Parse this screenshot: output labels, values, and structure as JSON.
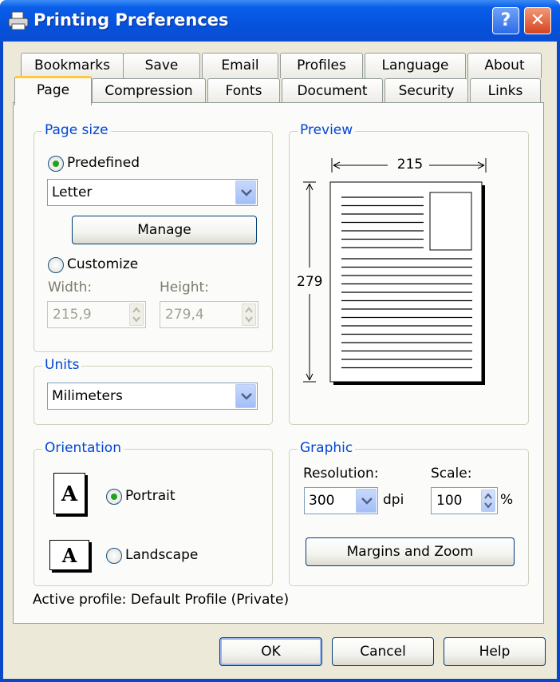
{
  "window": {
    "title": "Printing Preferences",
    "help_label": "?",
    "close_label": "✕"
  },
  "tabs_back": [
    "Bookmarks",
    "Save",
    "Email",
    "Profiles",
    "Language",
    "About"
  ],
  "tabs_front": [
    "Page",
    "Compression",
    "Fonts",
    "Document",
    "Security",
    "Links"
  ],
  "page_size": {
    "label": "Page size",
    "predefined_label": "Predefined",
    "predefined_selected": true,
    "paper_value": "Letter",
    "manage_label": "Manage",
    "customize_label": "Customize",
    "customize_selected": false,
    "width_label": "Width:",
    "width_value": "215,9",
    "height_label": "Height:",
    "height_value": "279,4"
  },
  "units": {
    "label": "Units",
    "value": "Milimeters"
  },
  "preview": {
    "label": "Preview",
    "width_dim": "215",
    "height_dim": "279"
  },
  "orientation": {
    "label": "Orientation",
    "portrait_label": "Portrait",
    "portrait_selected": true,
    "landscape_label": "Landscape",
    "landscape_selected": false,
    "icon_letter": "A"
  },
  "graphic": {
    "label": "Graphic",
    "resolution_label": "Resolution:",
    "resolution_value": "300",
    "dpi_label": "dpi",
    "scale_label": "Scale:",
    "scale_value": "100",
    "percent_label": "%",
    "margins_zoom_label": "Margins and Zoom"
  },
  "active_profile": "Active profile: Default Profile (Private)",
  "footer": {
    "ok_label": "OK",
    "cancel_label": "Cancel",
    "help_label": "Help"
  },
  "icons": [
    "printer-icon",
    "help-icon",
    "close-icon",
    "chevron-down-icon",
    "spin-arrows-icon",
    "portrait-page-icon",
    "landscape-page-icon"
  ],
  "colors": {
    "title_bar": "#0552dd",
    "group_label": "#0046d5",
    "active_tab_accent": "#ffc83c",
    "radio_dot": "#21a121",
    "dialog_bg": "#ece9d8"
  }
}
